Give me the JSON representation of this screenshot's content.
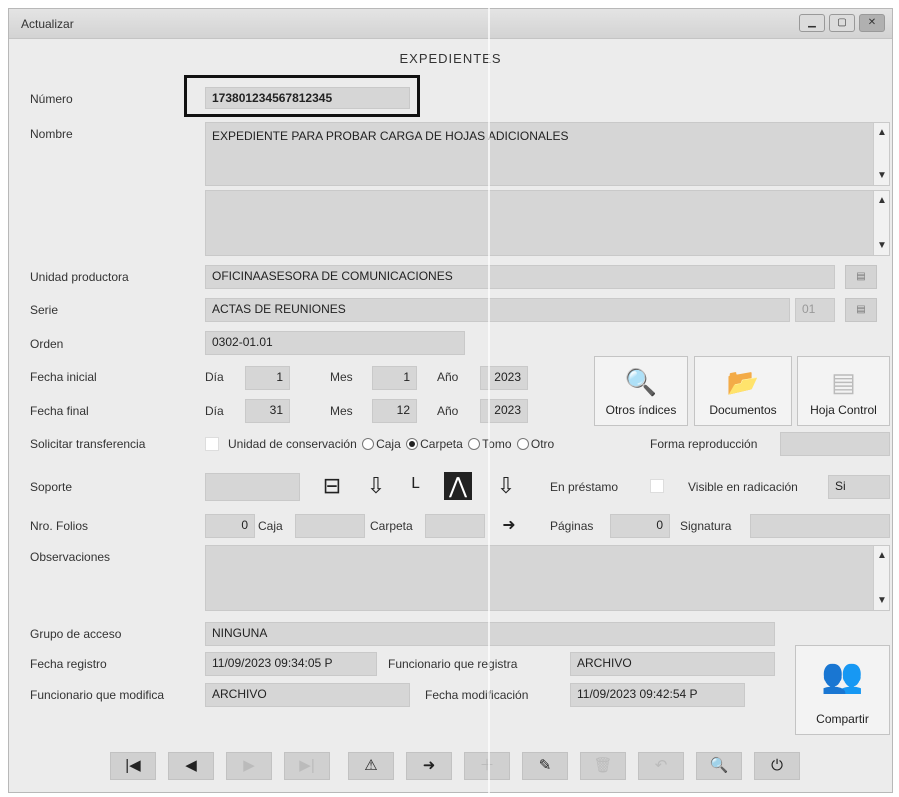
{
  "window": {
    "title": "Actualizar",
    "form_title": "EXPEDIENTES"
  },
  "fields": {
    "numero": {
      "label": "Número",
      "value": "173801234567812345"
    },
    "nombre": {
      "label": "Nombre",
      "value": "EXPEDIENTE PARA PROBAR CARGA DE HOJAS ADICIONALES"
    },
    "unidad": {
      "label": "Unidad productora",
      "value": "OFICINAASESORA DE COMUNICACIONES"
    },
    "serie": {
      "label": "Serie",
      "value": "ACTAS DE REUNIONES"
    },
    "orden": {
      "label": "Orden",
      "value": "0302-01.01"
    },
    "fecha_inicial": {
      "label": "Fecha inicial",
      "dia": "1",
      "mes": "1",
      "anio": "2023"
    },
    "fecha_final": {
      "label": "Fecha final",
      "dia": "31",
      "mes": "12",
      "anio": "2023"
    },
    "date_labels": {
      "dia": "Día",
      "mes": "Mes",
      "anio": "Año"
    },
    "transferencia": {
      "label": "Solicitar transferencia"
    },
    "conservacion": {
      "label": "Unidad de conservación",
      "options": [
        "Caja",
        "Carpeta",
        "Tomo",
        "Otro"
      ],
      "selected": "Carpeta"
    },
    "forma": {
      "label": "Forma reproducción",
      "value": ""
    },
    "soporte": {
      "label": "Soporte"
    },
    "prestamo": {
      "label": "En préstamo"
    },
    "visible": {
      "label": "Visible en radicación",
      "value": "Si"
    },
    "folios": {
      "label": "Nro. Folios",
      "value": "0"
    },
    "caja": {
      "label": "Caja"
    },
    "carpeta": {
      "label": "Carpeta"
    },
    "paginas": {
      "label": "Páginas",
      "value": "0"
    },
    "signatura": {
      "label": "Signatura"
    },
    "observaciones": {
      "label": "Observaciones"
    },
    "grupo": {
      "label": "Grupo de acceso",
      "value": "NINGUNA"
    },
    "fecha_registro": {
      "label": "Fecha registro",
      "value": "11/09/2023 09:34:05 P"
    },
    "func_registra": {
      "label": "Funcionario que registra",
      "value": "ARCHIVO"
    },
    "func_modifica": {
      "label": "Funcionario que modifica",
      "value": "ARCHIVO"
    },
    "fecha_mod": {
      "label": "Fecha modificación",
      "value": "11/09/2023 09:42:54 P"
    }
  },
  "buttons": {
    "otros": "Otros índices",
    "documentos": "Documentos",
    "hoja": "Hoja Control",
    "compartir": "Compartir",
    "serie_code": "01"
  }
}
